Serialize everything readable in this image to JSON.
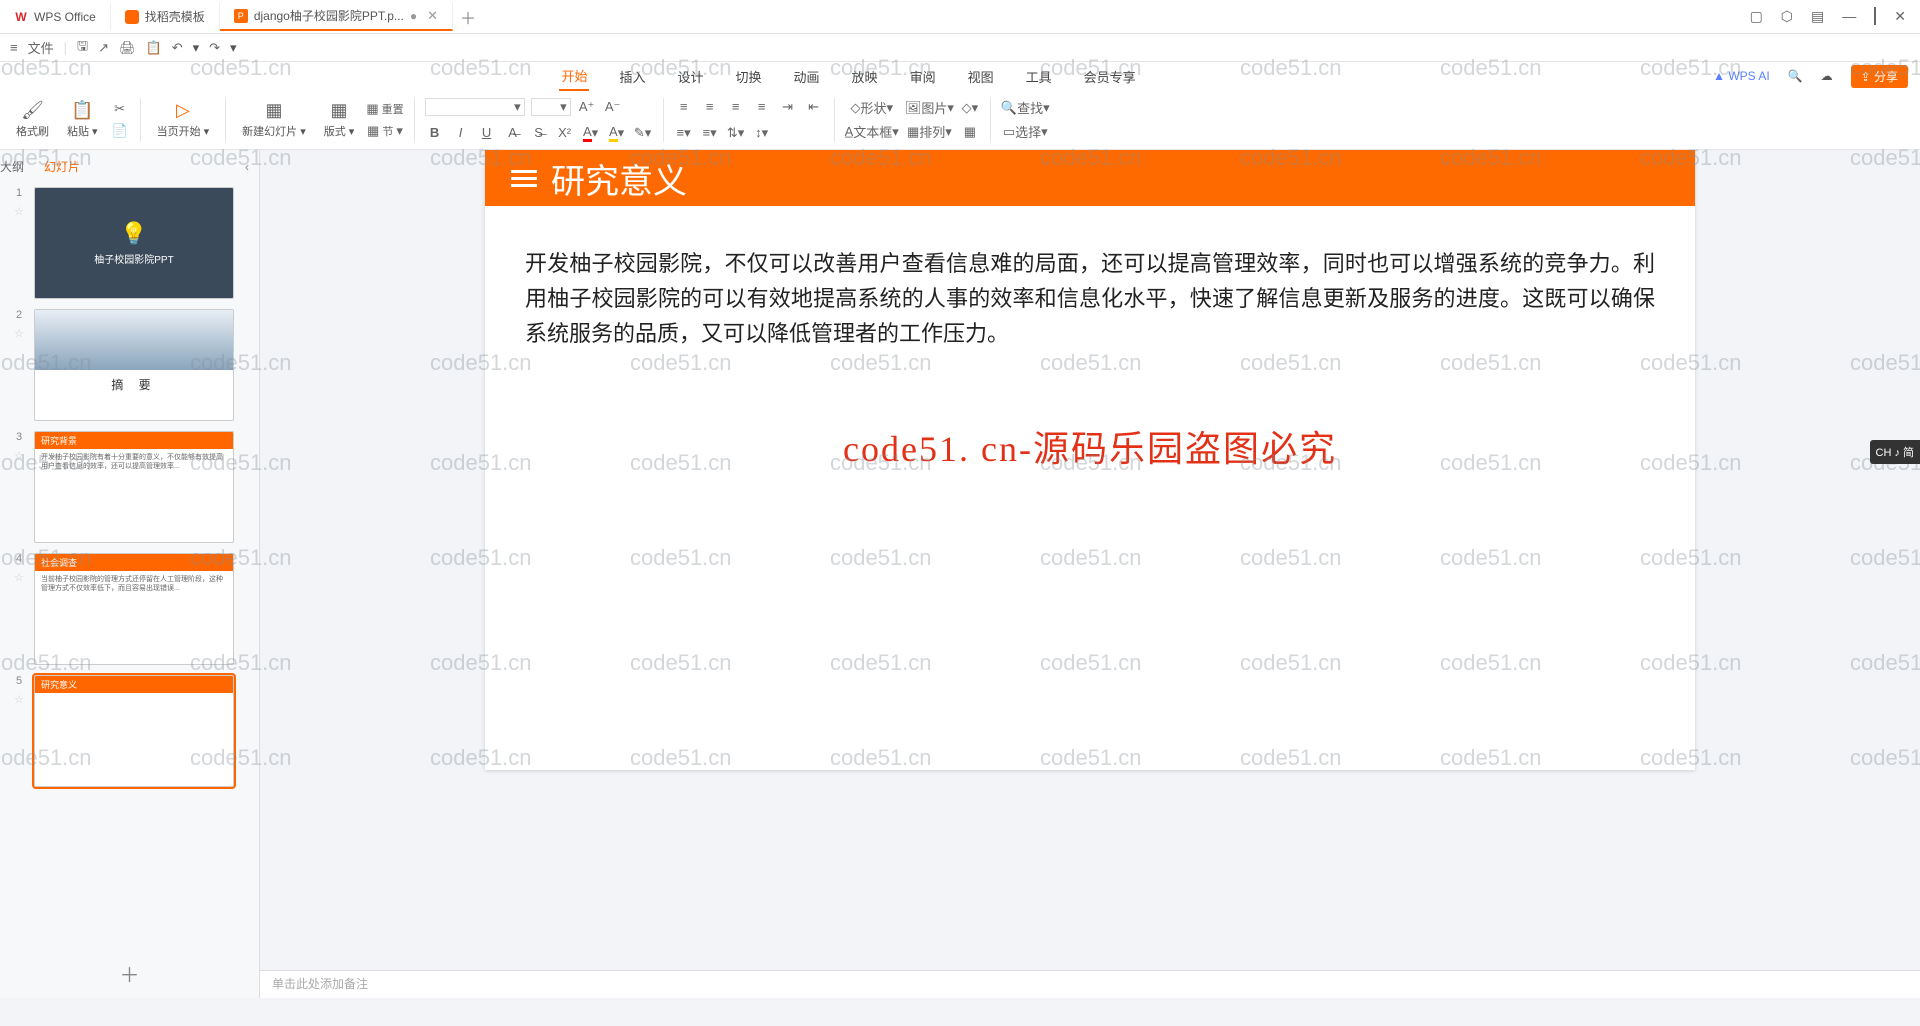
{
  "titlebar": {
    "tabs": [
      {
        "label": "WPS Office",
        "icon": "wps"
      },
      {
        "label": "找稻壳模板",
        "icon": "docao"
      },
      {
        "label": "django柚子校园影院PPT.p...",
        "icon": "ppt",
        "active": true,
        "modified": true
      }
    ],
    "win_controls": [
      "▢",
      "⬡",
      "▤",
      "—",
      "▢",
      "✕"
    ]
  },
  "quickbar": {
    "menu_icon": "≡",
    "file": "文件",
    "icons": [
      "🖫",
      "↗",
      "🖨",
      "📋",
      "↶",
      "↷"
    ]
  },
  "ribbon": {
    "tabs": [
      "开始",
      "插入",
      "设计",
      "切换",
      "动画",
      "放映",
      "审阅",
      "视图",
      "工具",
      "会员专享"
    ],
    "active": "开始",
    "ai": "WPS AI",
    "cloud": "☁",
    "share": "分享"
  },
  "toolbar": {
    "format_brush": "格式刷",
    "paste": "粘贴",
    "start_page": "当页开始",
    "new_slide": "新建幻灯片",
    "layout": "版式",
    "reset": "重置",
    "section": "节",
    "shape": "形状",
    "picture": "图片",
    "textbox": "文本框",
    "arrange": "排列",
    "find": "查找",
    "select": "选择"
  },
  "sidebar": {
    "outline": "大纲",
    "slides": "幻灯片",
    "thumbs": [
      {
        "num": "1",
        "title": "柚子校园影院PPT"
      },
      {
        "num": "2",
        "title": "摘  要"
      },
      {
        "num": "3",
        "bar": "研究背景",
        "body": "开发柚子校园影院有着十分重要的意义，不仅能够有效提高用户查看信息的效率，还可以提高管理效率..."
      },
      {
        "num": "4",
        "bar": "社会调查",
        "body": "当前柚子校园影院的管理方式还停留在人工管理阶段，这种管理方式不仅效率低下，而且容易出现错误..."
      },
      {
        "num": "5",
        "bar": "研究意义",
        "body": "",
        "selected": true
      }
    ]
  },
  "slide": {
    "header_title": "研究意义",
    "body": "开发柚子校园影院，不仅可以改善用户查看信息难的局面，还可以提高管理效率，同时也可以增强系统的竞争力。利用柚子校园影院的可以有效地提高系统的人事的效率和信息化水平，快速了解信息更新及服务的进度。这既可以确保系统服务的品质，又可以降低管理者的工作压力。",
    "center_wm": "code51. cn-源码乐园盗图必究"
  },
  "notes_placeholder": "单击此处添加备注",
  "watermark_text": "code51.cn",
  "ime": "CH ♪ 简"
}
